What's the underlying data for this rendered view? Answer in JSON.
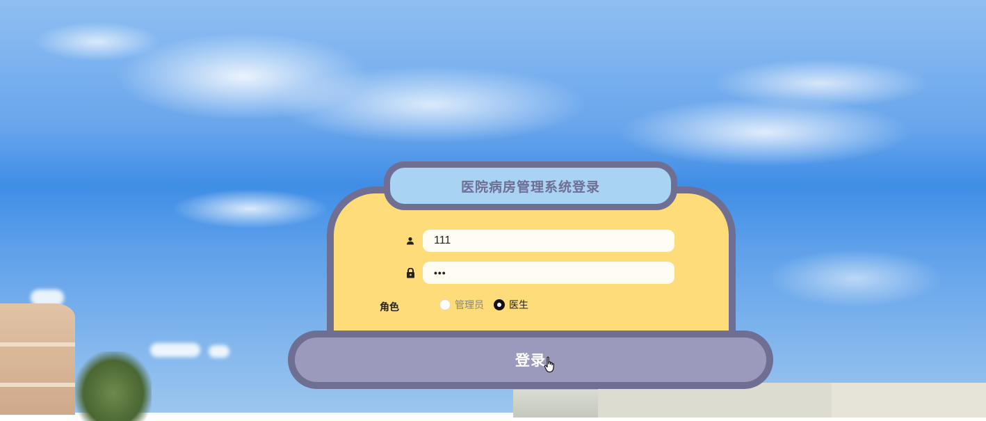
{
  "title": "医院病房管理系统登录",
  "form": {
    "username_value": "111",
    "password_value": "•••",
    "role_label": "角色",
    "roles": [
      {
        "label": "管理员",
        "selected": false
      },
      {
        "label": "医生",
        "selected": true
      }
    ]
  },
  "login_button": {
    "label": "登录"
  },
  "colors": {
    "frame": "#6f6e93",
    "card": "#ffdc7a",
    "title_bar": "#a9d3f2",
    "button": "#9b9abc"
  },
  "icons": {
    "user": "user-icon",
    "lock": "lock-icon",
    "cursor": "hand-pointer-icon"
  }
}
